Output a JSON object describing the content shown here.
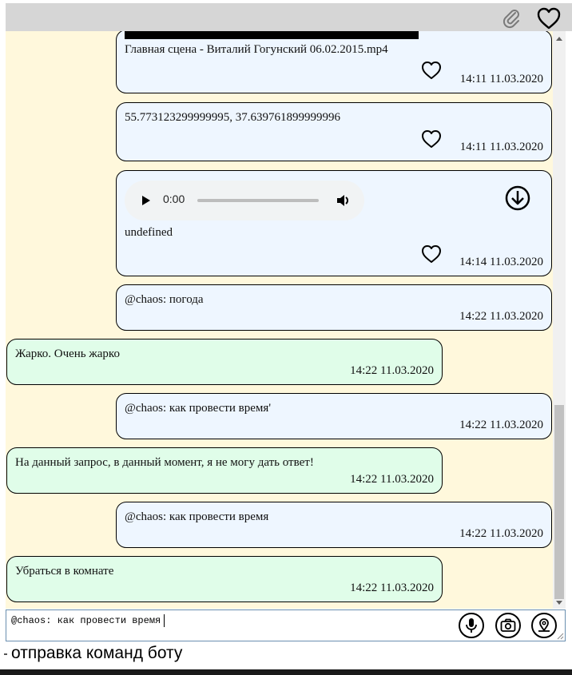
{
  "toolbar": {
    "attach_icon": "paperclip-icon",
    "favorite_icon": "heart-icon"
  },
  "messages": [
    {
      "type": "video",
      "direction": "out",
      "text": "Главная сцена - Виталий Гогунский 06.02.2015.mp4",
      "time": "14:11 11.03.2020",
      "liked": false
    },
    {
      "type": "location",
      "direction": "out",
      "text": "55.773123299999995, 37.639761899999996",
      "time": "14:11 11.03.2020",
      "liked": false
    },
    {
      "type": "audio",
      "direction": "out",
      "player_time": "0:00",
      "progress": 0,
      "text": "undefined",
      "time": "14:14 11.03.2020",
      "liked": false
    },
    {
      "type": "text",
      "direction": "out",
      "text": "@chaos: погода",
      "time": "14:22 11.03.2020"
    },
    {
      "type": "text",
      "direction": "in",
      "text": "Жарко. Очень жарко",
      "time": "14:22 11.03.2020"
    },
    {
      "type": "text",
      "direction": "out",
      "text": "@chaos: как провести время'",
      "time": "14:22 11.03.2020"
    },
    {
      "type": "text",
      "direction": "in",
      "text": "На данный запрос, в данный момент, я не могу дать ответ!",
      "time": "14:22 11.03.2020"
    },
    {
      "type": "text",
      "direction": "out",
      "text": "@chaos: как провести время",
      "time": "14:22 11.03.2020"
    },
    {
      "type": "text",
      "direction": "in",
      "text": "Убраться в комнате",
      "time": "14:22 11.03.2020"
    }
  ],
  "composer": {
    "value": "@chaos: как провести время",
    "mic_icon": "microphone-icon",
    "camera_icon": "camera-icon",
    "location_icon": "location-pin-icon"
  },
  "footer": {
    "label": "отправка команд боту"
  },
  "colors": {
    "chat_bg": "#fff8dc",
    "outgoing_bubble": "#eef6ff",
    "incoming_bubble": "#e0fde9",
    "toolbar_bg": "#d6d6d6"
  }
}
